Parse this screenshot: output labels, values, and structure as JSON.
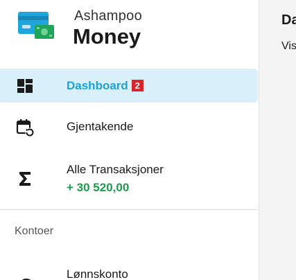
{
  "brand": {
    "top": "Ashampoo",
    "main": "Money"
  },
  "nav": {
    "items": [
      {
        "label": "Dashboard",
        "badge": "2",
        "icon": "dashboard-icon",
        "active": true
      },
      {
        "label": "Gjentakende",
        "icon": "calendar-recurring-icon"
      },
      {
        "label": "Alle Transaksjoner",
        "amount": "+ 30 520,00",
        "icon": "sigma-icon"
      }
    ]
  },
  "accounts": {
    "section_label": "Kontoer",
    "items": [
      {
        "label": "Lønnskonto",
        "icon": "account-icon"
      }
    ]
  },
  "main": {
    "title": "Da",
    "subtitle": "Vis"
  },
  "colors": {
    "accent": "#1aa3d9",
    "active_bg": "#d9eff9",
    "positive": "#1a9b4a",
    "badge": "#d9262e",
    "card_primary": "#1fa6dd",
    "card_secondary": "#22a35a"
  }
}
